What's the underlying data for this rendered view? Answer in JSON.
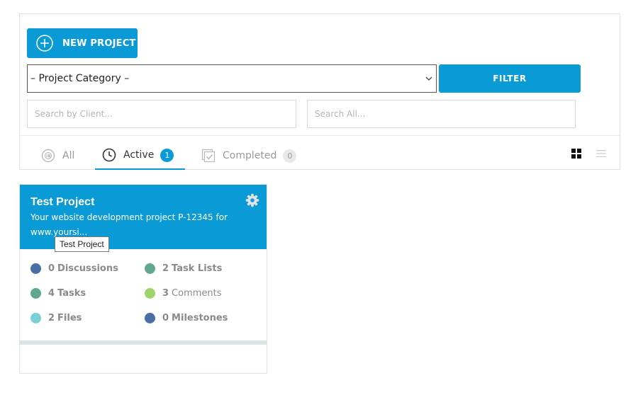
{
  "toolbar": {
    "new_project_label": "NEW PROJECT",
    "category_select_value": "– Project Category –",
    "filter_label": "FILTER",
    "search_client_placeholder": "Search by Client...",
    "search_all_placeholder": "Search All..."
  },
  "tabs": {
    "all": {
      "label": "All"
    },
    "active": {
      "label": "Active",
      "count": "1"
    },
    "completed": {
      "label": "Completed",
      "count": "0"
    }
  },
  "project_card": {
    "title": "Test Project",
    "description": "Your website development project P-12345 for www.yoursi...",
    "tooltip": "Test Project",
    "stats": [
      {
        "num": "0",
        "label": "Discussions",
        "color": "#4a6fa5"
      },
      {
        "num": "2",
        "label": "Task Lists",
        "color": "#5fa88f"
      },
      {
        "num": "4",
        "label": "Tasks",
        "color": "#5fa88f"
      },
      {
        "num": "3",
        "label": "Comments",
        "color": "#9ed46a"
      },
      {
        "num": "2",
        "label": "Files",
        "color": "#7ccfd6"
      },
      {
        "num": "0",
        "label": "Milestones",
        "color": "#4a6fa5"
      }
    ]
  },
  "colors": {
    "accent": "#0a9ad6"
  }
}
